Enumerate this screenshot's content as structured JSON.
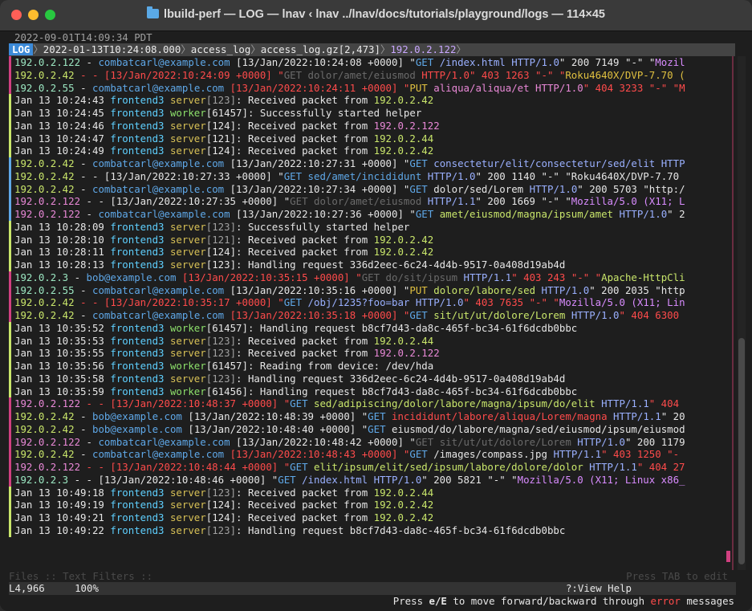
{
  "window": {
    "title": "lbuild-perf — LOG — lnav ‹ lnav ../lnav/docs/tutorials/playground/logs — 114×45"
  },
  "clock": "2022-09-01T14:09:34 PDT",
  "crumb": {
    "tag": "LOG",
    "time": "2022-01-13T10:24:08.000",
    "format": "access_log",
    "file": "access_log.gz[2,473]",
    "value": "192.0.2.122"
  },
  "rows": [
    {
      "mark": "#d04080",
      "segs": [
        [
          "ip",
          "192.0.2.122"
        ],
        [
          "",
          "",
          " - "
        ],
        [
          "user",
          "combatcarl@example.com"
        ],
        [
          "",
          " [13/Jan/2022:10:24:08 +0000] \""
        ],
        [
          "get",
          "GET"
        ],
        [
          "",
          " "
        ],
        [
          "path",
          "/index.html"
        ],
        [
          "",
          " "
        ],
        [
          "path",
          "HTTP/1.0"
        ],
        [
          "",
          "\" 200 7149 \"-\" \""
        ],
        [
          "ua",
          "Mozil"
        ]
      ]
    },
    {
      "mark": "#d04080",
      "segs": [
        [
          "ipg",
          "192.0.2.42"
        ],
        [
          "err",
          " - - [13/Jan/2022:10:24:09 +0000] \""
        ],
        [
          "dim",
          "GET "
        ],
        [
          "dim",
          "dolor/amet/eiusmod"
        ],
        [
          "err",
          " HTTP/1.0\" 403 1263 \"-\" \""
        ],
        [
          "warn",
          "Roku4640X/DVP-7.70 ("
        ]
      ]
    },
    {
      "mark": "#d04080",
      "segs": [
        [
          "ip",
          "192.0.2.55"
        ],
        [
          "",
          " - "
        ],
        [
          "user",
          "combatcarl@example.com"
        ],
        [
          "err",
          " [13/Jan/2022:10:24:11 +0000] \""
        ],
        [
          "warn",
          "PUT "
        ],
        [
          "pink",
          "aliqua/aliqua/et"
        ],
        [
          "pink",
          " HTTP/1.0"
        ],
        [
          "err",
          "\" 404 3233 \"-\" \"M"
        ]
      ]
    },
    {
      "mark": "#c9e66b",
      "segs": [
        [
          "",
          "Jan 13 10:24:43 "
        ],
        [
          "svc",
          "frontend3"
        ],
        [
          "",
          " "
        ],
        [
          "srv",
          "server"
        ],
        [
          "pid",
          "[123]"
        ],
        [
          "",
          ": Received packet from "
        ],
        [
          "grn",
          "192.0.2.42"
        ]
      ]
    },
    {
      "mark": "#c9e66b",
      "segs": [
        [
          "",
          "Jan 13 10:24:45 "
        ],
        [
          "svc",
          "frontend3"
        ],
        [
          "",
          " "
        ],
        [
          "worker",
          "worker"
        ],
        [
          "",
          "[61457]: Successfully started helper"
        ]
      ]
    },
    {
      "mark": "#c9e66b",
      "segs": [
        [
          "",
          "Jan 13 10:24:46 "
        ],
        [
          "svc",
          "frontend3"
        ],
        [
          "",
          " "
        ],
        [
          "srv",
          "server"
        ],
        [
          "",
          "[124]: Received packet from "
        ],
        [
          "pink",
          "192.0.2.122"
        ]
      ]
    },
    {
      "mark": "#c9e66b",
      "segs": [
        [
          "",
          "Jan 13 10:24:47 "
        ],
        [
          "svc",
          "frontend3"
        ],
        [
          "",
          " "
        ],
        [
          "srv",
          "server"
        ],
        [
          "",
          "[121]: Received packet from "
        ],
        [
          "grn",
          "192.0.2.44"
        ]
      ]
    },
    {
      "mark": "#c9e66b",
      "segs": [
        [
          "",
          "Jan 13 10:24:49 "
        ],
        [
          "svc",
          "frontend3"
        ],
        [
          "",
          " "
        ],
        [
          "srv",
          "server"
        ],
        [
          "",
          "[124]: Received packet from "
        ],
        [
          "grn",
          "192.0.2.42"
        ]
      ]
    },
    {
      "mark": "#5fa8e8",
      "segs": [
        [
          "ipg",
          "192.0.2.42"
        ],
        [
          "",
          " - "
        ],
        [
          "user",
          "combatcarl@example.com"
        ],
        [
          "",
          " [13/Jan/2022:10:27:31 +0000] \""
        ],
        [
          "get",
          "GET "
        ],
        [
          "path",
          "consectetur/elit/consectetur/sed/elit"
        ],
        [
          "path",
          " HTTP"
        ]
      ]
    },
    {
      "mark": "#5fa8e8",
      "segs": [
        [
          "ipg",
          "192.0.2.42"
        ],
        [
          "",
          " - - [13/Jan/2022:10:27:33 +0000] \""
        ],
        [
          "get",
          "GET "
        ],
        [
          "get",
          "sed/amet/incididunt"
        ],
        [
          "path",
          " HTTP/1.0"
        ],
        [
          "",
          "\" 200 1140 \"-\" \"Roku4640X/DVP-7.70"
        ]
      ]
    },
    {
      "mark": "#5fa8e8",
      "segs": [
        [
          "ipg",
          "192.0.2.42"
        ],
        [
          "",
          " - "
        ],
        [
          "user",
          "combatcarl@example.com"
        ],
        [
          "",
          " [13/Jan/2022:10:27:34 +0000] \""
        ],
        [
          "get",
          "GET "
        ],
        [
          "",
          "dolor/sed/Lorem"
        ],
        [
          "path",
          " HTTP/1.0"
        ],
        [
          "",
          "\" 200 5703 \"http:/"
        ]
      ]
    },
    {
      "mark": "#5fa8e8",
      "segs": [
        [
          "pink",
          "192.0.2.122"
        ],
        [
          "",
          " - - [13/Jan/2022:10:27:35 +0000] \""
        ],
        [
          "dim",
          "GET "
        ],
        [
          "dim",
          "dolor/amet/eiusmod"
        ],
        [
          "path",
          " HTTP/1.1"
        ],
        [
          "",
          "\" 200 1669 \"-\" \""
        ],
        [
          "ua",
          "Mozilla/5.0 (X11; L"
        ]
      ]
    },
    {
      "mark": "#5fa8e8",
      "segs": [
        [
          "pink",
          "192.0.2.122"
        ],
        [
          "",
          " - "
        ],
        [
          "user",
          "combatcarl@example.com"
        ],
        [
          "",
          " [13/Jan/2022:10:27:36 +0000] \""
        ],
        [
          "get",
          "GET "
        ],
        [
          "grn",
          "amet/eiusmod/magna/ipsum/amet"
        ],
        [
          "path",
          " HTTP/1.0"
        ],
        [
          "",
          "\" 2"
        ]
      ]
    },
    {
      "mark": "#c9e66b",
      "segs": [
        [
          "",
          "Jan 13 10:28:09 "
        ],
        [
          "svc",
          "frontend3"
        ],
        [
          "",
          " "
        ],
        [
          "srv",
          "server"
        ],
        [
          "pid",
          "[123]"
        ],
        [
          "",
          ": Successfully started helper"
        ]
      ]
    },
    {
      "mark": "#c9e66b",
      "segs": [
        [
          "",
          "Jan 13 10:28:10 "
        ],
        [
          "svc",
          "frontend3"
        ],
        [
          "",
          " "
        ],
        [
          "srv",
          "server"
        ],
        [
          "pid",
          "[121]"
        ],
        [
          "",
          ": Received packet from "
        ],
        [
          "grn",
          "192.0.2.42"
        ]
      ]
    },
    {
      "mark": "#c9e66b",
      "segs": [
        [
          "",
          "Jan 13 10:28:11 "
        ],
        [
          "svc",
          "frontend3"
        ],
        [
          "",
          " "
        ],
        [
          "srv",
          "server"
        ],
        [
          "",
          "[124]: Received packet from "
        ],
        [
          "grn",
          "192.0.2.42"
        ]
      ]
    },
    {
      "mark": "#c9e66b",
      "segs": [
        [
          "",
          "Jan 13 10:28:13 "
        ],
        [
          "svc",
          "frontend3"
        ],
        [
          "",
          " "
        ],
        [
          "srv",
          "server"
        ],
        [
          "",
          "[123]: Handling request 336d2eec-6c24-4d4b-9517-0a408d19ab4d"
        ]
      ]
    },
    {
      "mark": "#d04080",
      "segs": [
        [
          "ip",
          "192.0.2.3"
        ],
        [
          "",
          " - "
        ],
        [
          "user",
          "bob@example.com"
        ],
        [
          "err",
          " [13/Jan/2022:10:35:15 +0000] \""
        ],
        [
          "dim",
          "GET "
        ],
        [
          "dim",
          "do/sit/ipsum"
        ],
        [
          "path",
          " HTTP/1.1"
        ],
        [
          "err",
          "\" 403 243 \"-\" \""
        ],
        [
          "grn",
          "Apache-HttpCli"
        ]
      ]
    },
    {
      "mark": "#d04080",
      "segs": [
        [
          "ip",
          "192.0.2.55"
        ],
        [
          "",
          " - "
        ],
        [
          "user",
          "combatcarl@example.com"
        ],
        [
          "",
          " [13/Jan/2022:10:35:16 +0000] \""
        ],
        [
          "warn",
          "PUT "
        ],
        [
          "grn",
          "dolore/labore/sed"
        ],
        [
          "path",
          " HTTP/1.0"
        ],
        [
          "",
          "\" 200 2035 \"http"
        ]
      ]
    },
    {
      "mark": "#d04080",
      "segs": [
        [
          "ipg",
          "192.0.2.42"
        ],
        [
          "err",
          " - - [13/Jan/2022:10:35:17 +0000] \""
        ],
        [
          "get",
          "GET "
        ],
        [
          "path",
          "/obj/1235?foo=bar"
        ],
        [
          "path",
          " HTTP/1.0"
        ],
        [
          "err",
          "\" 403 7635 \"-\" \""
        ],
        [
          "ua",
          "Mozilla/5.0 (X11; Lin"
        ]
      ]
    },
    {
      "mark": "#d04080",
      "segs": [
        [
          "ipg",
          "192.0.2.42"
        ],
        [
          "",
          " - "
        ],
        [
          "user",
          "combatcarl@example.com"
        ],
        [
          "err",
          " [13/Jan/2022:10:35:18 +0000] \""
        ],
        [
          "get",
          "GET "
        ],
        [
          "grn",
          "sit/ut/ut/dolore/Lorem"
        ],
        [
          "path",
          " HTTP/1.0"
        ],
        [
          "err",
          "\" 404 6300"
        ]
      ]
    },
    {
      "mark": "#c9e66b",
      "segs": [
        [
          "",
          "Jan 13 10:35:52 "
        ],
        [
          "svc",
          "frontend3"
        ],
        [
          "",
          " "
        ],
        [
          "worker",
          "worker"
        ],
        [
          "",
          "[61457]: Handling request b8cf7d43-da8c-465f-bc34-61f6dcdb0bbc"
        ]
      ]
    },
    {
      "mark": "#c9e66b",
      "segs": [
        [
          "",
          "Jan 13 10:35:53 "
        ],
        [
          "svc",
          "frontend3"
        ],
        [
          "",
          " "
        ],
        [
          "srv",
          "server"
        ],
        [
          "pid",
          "[123]"
        ],
        [
          "",
          ": Received packet from "
        ],
        [
          "grn",
          "192.0.2.44"
        ]
      ]
    },
    {
      "mark": "#c9e66b",
      "segs": [
        [
          "",
          "Jan 13 10:35:55 "
        ],
        [
          "svc",
          "frontend3"
        ],
        [
          "",
          " "
        ],
        [
          "srv",
          "server"
        ],
        [
          "pid",
          "[123]"
        ],
        [
          "",
          ": Received packet from "
        ],
        [
          "pink",
          "192.0.2.122"
        ]
      ]
    },
    {
      "mark": "#c9e66b",
      "segs": [
        [
          "",
          "Jan 13 10:35:56 "
        ],
        [
          "svc",
          "frontend3"
        ],
        [
          "",
          " "
        ],
        [
          "worker",
          "worker"
        ],
        [
          "",
          "[61457]: Reading from device: /dev/hda"
        ]
      ]
    },
    {
      "mark": "#c9e66b",
      "segs": [
        [
          "",
          "Jan 13 10:35:58 "
        ],
        [
          "svc",
          "frontend3"
        ],
        [
          "",
          " "
        ],
        [
          "srv",
          "server"
        ],
        [
          "pid",
          "[123]"
        ],
        [
          "",
          ": Handling request 336d2eec-6c24-4d4b-9517-0a408d19ab4d"
        ]
      ]
    },
    {
      "mark": "#c9e66b",
      "segs": [
        [
          "",
          "Jan 13 10:35:59 "
        ],
        [
          "svc",
          "frontend3"
        ],
        [
          "",
          " "
        ],
        [
          "worker",
          "worker"
        ],
        [
          "",
          "[61456]: Handling request b8cf7d43-da8c-465f-bc34-61f6dcdb0bbc"
        ]
      ]
    },
    {
      "mark": "#d04080",
      "segs": [
        [
          "pink",
          "192.0.2.122"
        ],
        [
          "err",
          " - - [13/Jan/2022:10:48:37 +0000] \""
        ],
        [
          "get",
          "GET "
        ],
        [
          "grn",
          "sed/adipiscing/dolor/labore/magna/ipsum/do/elit"
        ],
        [
          "path",
          " HTTP/1.1"
        ],
        [
          "err",
          "\" 404"
        ]
      ]
    },
    {
      "mark": "#d04080",
      "segs": [
        [
          "ipg",
          "192.0.2.42"
        ],
        [
          "",
          " - "
        ],
        [
          "user",
          "bob@example.com"
        ],
        [
          "",
          " [13/Jan/2022:10:48:39 +0000] \""
        ],
        [
          "get",
          "GET "
        ],
        [
          "err",
          "incididunt/labore/aliqua/Lorem/magna"
        ],
        [
          "path",
          " HTTP/1.1"
        ],
        [
          "",
          "\" 20"
        ]
      ]
    },
    {
      "mark": "#d04080",
      "segs": [
        [
          "ipg",
          "192.0.2.42"
        ],
        [
          "",
          " - "
        ],
        [
          "user",
          "bob@example.com"
        ],
        [
          "",
          " [13/Jan/2022:10:48:40 +0000] \""
        ],
        [
          "get",
          "GET "
        ],
        [
          "",
          "eiusmod/do/labore/magna/sed/eiusmod/ipsum/eiusmod"
        ]
      ]
    },
    {
      "mark": "#d04080",
      "segs": [
        [
          "pink",
          "192.0.2.122"
        ],
        [
          "",
          " - "
        ],
        [
          "user",
          "combatcarl@example.com"
        ],
        [
          "",
          " [13/Jan/2022:10:48:42 +0000] \""
        ],
        [
          "dim",
          "GET "
        ],
        [
          "dim",
          "sit/ut/ut/dolore/Lorem"
        ],
        [
          "path",
          " HTTP/1.0"
        ],
        [
          "",
          "\" 200 1179"
        ]
      ]
    },
    {
      "mark": "#d04080",
      "segs": [
        [
          "ipg",
          "192.0.2.42"
        ],
        [
          "",
          " - "
        ],
        [
          "user",
          "combatcarl@example.com"
        ],
        [
          "err",
          " [13/Jan/2022:10:48:43 +0000] \""
        ],
        [
          "get",
          "GET "
        ],
        [
          "",
          "/images/compass.jpg"
        ],
        [
          "path",
          " HTTP/1.1"
        ],
        [
          "err",
          "\" 403 1250 \"-"
        ]
      ]
    },
    {
      "mark": "#d04080",
      "segs": [
        [
          "pink",
          "192.0.2.122"
        ],
        [
          "err",
          " - - [13/Jan/2022:10:48:44 +0000] \""
        ],
        [
          "get",
          "GET "
        ],
        [
          "grn",
          "elit/ipsum/elit/sed/ipsum/labore/dolore/dolor"
        ],
        [
          "path",
          " HTTP/1.1"
        ],
        [
          "err",
          "\" 404 27"
        ]
      ]
    },
    {
      "mark": "#d04080",
      "segs": [
        [
          "ip",
          "192.0.2.3"
        ],
        [
          "",
          " - - [13/Jan/2022:10:48:46 +0000] \""
        ],
        [
          "get",
          "GET "
        ],
        [
          "path",
          "/index.html"
        ],
        [
          "path",
          " HTTP/1.0"
        ],
        [
          "",
          "\" 200 5821 \"-\" \""
        ],
        [
          "ua",
          "Mozilla/5.0 (X11; Linux x86_"
        ]
      ]
    },
    {
      "mark": "#c9e66b",
      "segs": [
        [
          "",
          "Jan 13 10:49:18 "
        ],
        [
          "svc",
          "frontend3"
        ],
        [
          "",
          " "
        ],
        [
          "srv",
          "server"
        ],
        [
          "pid",
          "[123]"
        ],
        [
          "",
          ": Received packet from "
        ],
        [
          "grn",
          "192.0.2.44"
        ]
      ]
    },
    {
      "mark": "#c9e66b",
      "segs": [
        [
          "",
          "Jan 13 10:49:19 "
        ],
        [
          "svc",
          "frontend3"
        ],
        [
          "",
          " "
        ],
        [
          "srv",
          "server"
        ],
        [
          "",
          "[124]: Received packet from "
        ],
        [
          "grn",
          "192.0.2.42"
        ]
      ]
    },
    {
      "mark": "#c9e66b",
      "segs": [
        [
          "",
          "Jan 13 10:49:21 "
        ],
        [
          "svc",
          "frontend3"
        ],
        [
          "",
          " "
        ],
        [
          "srv",
          "server"
        ],
        [
          "",
          "[124]: Received packet from "
        ],
        [
          "grn",
          "192.0.2.42"
        ]
      ]
    },
    {
      "mark": "#c9e66b",
      "segs": [
        [
          "",
          "Jan 13 10:49:22 "
        ],
        [
          "svc",
          "frontend3"
        ],
        [
          "",
          " "
        ],
        [
          "srv",
          "server"
        ],
        [
          "pid",
          "[123]"
        ],
        [
          "",
          ": Handling request b8cf7d43-da8c-465f-bc34-61f6dcdb0bbc"
        ]
      ]
    }
  ],
  "status": {
    "left": "Files :: Text Filters ::",
    "right": "Press TAB to edit"
  },
  "bottom": {
    "line": "L4,966",
    "percent": "100%",
    "help": "?:View Help"
  },
  "help": {
    "pre": "Press ",
    "key": "e/E",
    "mid": " to move forward/backward through ",
    "err": "error",
    "post": " messages"
  }
}
